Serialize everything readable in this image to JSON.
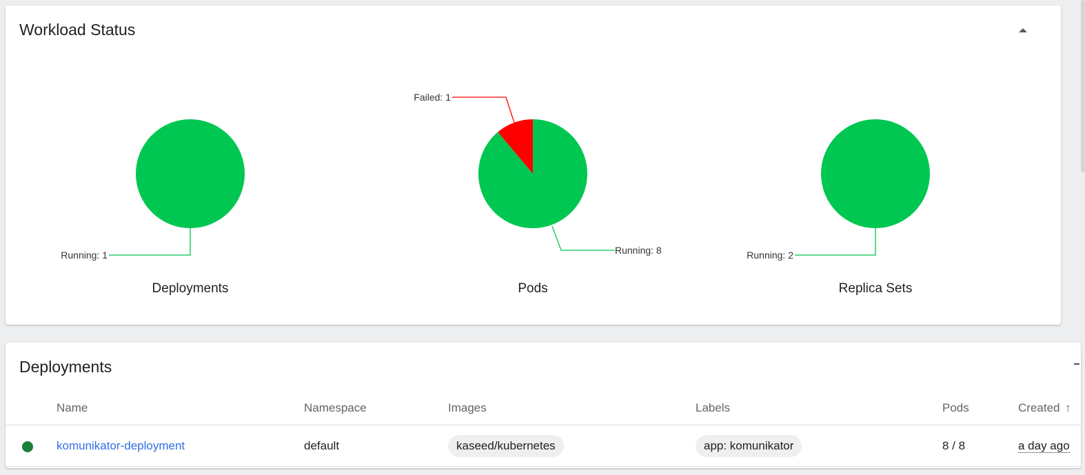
{
  "workload_status": {
    "title": "Workload Status",
    "charts": [
      {
        "name": "Deployments",
        "slices": [
          {
            "label": "Running: 1",
            "value": 1,
            "color": "#00c752"
          }
        ]
      },
      {
        "name": "Pods",
        "slices": [
          {
            "label": "Running: 8",
            "value": 8,
            "color": "#00c752"
          },
          {
            "label": "Failed: 1",
            "value": 1,
            "color": "#ff0000"
          }
        ]
      },
      {
        "name": "Replica Sets",
        "slices": [
          {
            "label": "Running: 2",
            "value": 2,
            "color": "#00c752"
          }
        ]
      }
    ]
  },
  "deployments": {
    "title": "Deployments",
    "columns": [
      "Name",
      "Namespace",
      "Images",
      "Labels",
      "Pods",
      "Created"
    ],
    "sort_icon": "arrow-up-icon",
    "rows": [
      {
        "status": "running",
        "status_color": "#188038",
        "name": "komunikator-deployment",
        "namespace": "default",
        "image": "kaseed/kubernetes",
        "label": "app: komunikator",
        "pods": "8 / 8",
        "created": "a day ago"
      }
    ]
  },
  "chart_data": [
    {
      "type": "pie",
      "title": "Deployments",
      "categories": [
        "Running"
      ],
      "values": [
        1
      ]
    },
    {
      "type": "pie",
      "title": "Pods",
      "categories": [
        "Running",
        "Failed"
      ],
      "values": [
        8,
        1
      ]
    },
    {
      "type": "pie",
      "title": "Replica Sets",
      "categories": [
        "Running"
      ],
      "values": [
        2
      ]
    }
  ]
}
